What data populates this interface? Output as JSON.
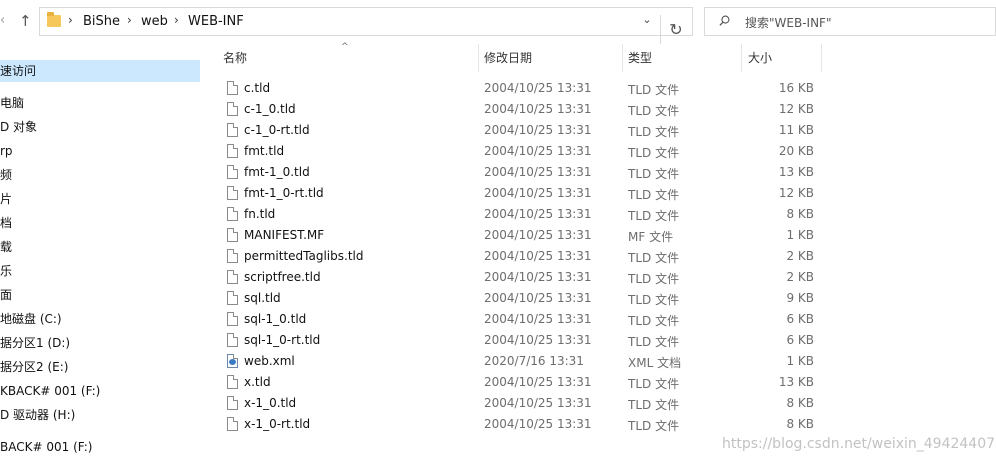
{
  "address": {
    "crumbs": [
      "BiShe",
      "web",
      "WEB-INF"
    ],
    "separator": "›"
  },
  "search": {
    "placeholder": "搜索\"WEB-INF\""
  },
  "nav": {
    "items": [
      "速访问",
      "电脑",
      "D 对象",
      "rp",
      "频",
      "片",
      "档",
      "载",
      "乐",
      "面",
      "地磁盘 (C:)",
      "据分区1 (D:)",
      "据分区2 (E:)",
      "KBACK# 001 (F:)",
      "D 驱动器 (H:)",
      "BACK# 001 (F:)"
    ]
  },
  "columns": {
    "name": "名称",
    "date": "修改日期",
    "type": "类型",
    "size": "大小"
  },
  "files": [
    {
      "name": "c.tld",
      "date": "2004/10/25 13:31",
      "type": "TLD 文件",
      "size": "16 KB",
      "icon": "file"
    },
    {
      "name": "c-1_0.tld",
      "date": "2004/10/25 13:31",
      "type": "TLD 文件",
      "size": "12 KB",
      "icon": "file"
    },
    {
      "name": "c-1_0-rt.tld",
      "date": "2004/10/25 13:31",
      "type": "TLD 文件",
      "size": "11 KB",
      "icon": "file"
    },
    {
      "name": "fmt.tld",
      "date": "2004/10/25 13:31",
      "type": "TLD 文件",
      "size": "20 KB",
      "icon": "file"
    },
    {
      "name": "fmt-1_0.tld",
      "date": "2004/10/25 13:31",
      "type": "TLD 文件",
      "size": "13 KB",
      "icon": "file"
    },
    {
      "name": "fmt-1_0-rt.tld",
      "date": "2004/10/25 13:31",
      "type": "TLD 文件",
      "size": "12 KB",
      "icon": "file"
    },
    {
      "name": "fn.tld",
      "date": "2004/10/25 13:31",
      "type": "TLD 文件",
      "size": "8 KB",
      "icon": "file"
    },
    {
      "name": "MANIFEST.MF",
      "date": "2004/10/25 13:31",
      "type": "MF 文件",
      "size": "1 KB",
      "icon": "file"
    },
    {
      "name": "permittedTaglibs.tld",
      "date": "2004/10/25 13:31",
      "type": "TLD 文件",
      "size": "2 KB",
      "icon": "file"
    },
    {
      "name": "scriptfree.tld",
      "date": "2004/10/25 13:31",
      "type": "TLD 文件",
      "size": "2 KB",
      "icon": "file"
    },
    {
      "name": "sql.tld",
      "date": "2004/10/25 13:31",
      "type": "TLD 文件",
      "size": "9 KB",
      "icon": "file"
    },
    {
      "name": "sql-1_0.tld",
      "date": "2004/10/25 13:31",
      "type": "TLD 文件",
      "size": "6 KB",
      "icon": "file"
    },
    {
      "name": "sql-1_0-rt.tld",
      "date": "2004/10/25 13:31",
      "type": "TLD 文件",
      "size": "6 KB",
      "icon": "file"
    },
    {
      "name": "web.xml",
      "date": "2020/7/16 13:31",
      "type": "XML 文档",
      "size": "1 KB",
      "icon": "xml"
    },
    {
      "name": "x.tld",
      "date": "2004/10/25 13:31",
      "type": "TLD 文件",
      "size": "13 KB",
      "icon": "file"
    },
    {
      "name": "x-1_0.tld",
      "date": "2004/10/25 13:31",
      "type": "TLD 文件",
      "size": "8 KB",
      "icon": "file"
    },
    {
      "name": "x-1_0-rt.tld",
      "date": "2004/10/25 13:31",
      "type": "TLD 文件",
      "size": "8 KB",
      "icon": "file"
    }
  ],
  "watermark": "https://blog.csdn.net/weixin_49424407",
  "icons": {
    "back": "back-arrow-icon",
    "up": "up-arrow-icon",
    "folder": "folder-icon",
    "dropdown": "chevron-down-icon",
    "refresh": "refresh-icon",
    "search": "search-icon"
  }
}
